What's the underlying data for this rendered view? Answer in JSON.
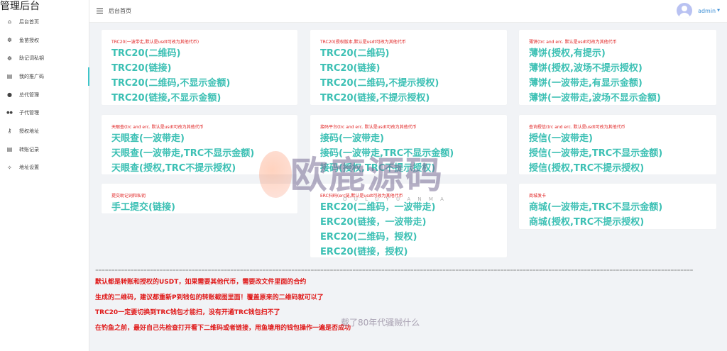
{
  "app": {
    "title": "管理后台"
  },
  "header": {
    "breadcrumb": "后台首页",
    "user": "admin",
    "caret": "▼"
  },
  "sidebar": {
    "items": [
      {
        "label": "后台首页",
        "icon": "home-icon",
        "glyph": "⌂"
      },
      {
        "label": "鱼苗授权",
        "icon": "fish-icon",
        "glyph": "☸"
      },
      {
        "label": "助记词私钥",
        "icon": "fish-icon",
        "glyph": "☸"
      },
      {
        "label": "我的推广码",
        "icon": "document-icon",
        "glyph": "▤"
      },
      {
        "label": "总代管理",
        "icon": "user-icon",
        "glyph": "●"
      },
      {
        "label": "子代管理",
        "icon": "users-icon",
        "glyph": "●●"
      },
      {
        "label": "授权地址",
        "icon": "key-icon",
        "glyph": "⚷"
      },
      {
        "label": "转账记录",
        "icon": "list-icon",
        "glyph": "▤"
      },
      {
        "label": "地址设置",
        "icon": "settings-icon",
        "glyph": "✧"
      }
    ]
  },
  "cards": [
    {
      "title": "TRC20(一波带走,默认是usdt可改为其他代币)",
      "links": [
        "TRC20(二维码)",
        "TRC20(链接)",
        "TRC20(二维码,不显示金额)",
        "TRC20(链接,不显示金额)"
      ]
    },
    {
      "title": "TRC20(授权版本,默认是usdt可改为其他代币",
      "links": [
        "TRC20(二维码)",
        "TRC20(链接)",
        "TRC20(二维码,不提示授权)",
        "TRC20(链接,不提示授权)"
      ]
    },
    {
      "title": "薄饼(trc and erc. 默认是usdt可改为其他代币",
      "links": [
        "薄饼(授权,有提示)",
        "薄饼(授权,波场不提示授权)",
        "薄饼(一波带走,有显示金额)",
        "薄饼(一波带走,波场不显示金额)"
      ]
    },
    {
      "title": "天眼查(trc and erc. 默认是usdt可改为其他代币",
      "links": [
        "天眼查(一波带走)",
        "天眼查(一波带走,TRC不显示金额)",
        "天眼查(授权,TRC不提示授权)"
      ]
    },
    {
      "title": "接码平台(trc and erc. 默认是usdt可改为其他代币",
      "links": [
        "接码(一波带走)",
        "接码(一波带走,TRC不显示金额)",
        "接码(授权,TRC不提示授权)"
      ]
    },
    {
      "title": "查询授信(trc and erc. 默认是usdt可改为其他代币",
      "links": [
        "授信(一波带走)",
        "授信(一波带走,TRC不显示金额)",
        "授信(授权,TRC不提示授权)"
      ]
    },
    {
      "title": "提交助记词和私钥",
      "links": [
        "手工提交(链接)"
      ]
    },
    {
      "title": "ERC扫码(erc链,默认是usdt可改为其他代币",
      "links": [
        "ERC20(二维码，一波带走)",
        "ERC20(链接，一波带走)",
        "ERC20(二维码，授权)",
        "ERC20(链接，授权)"
      ]
    },
    {
      "title": "商城发卡",
      "links": [
        "商城(一波带走,TRC不显示金额)",
        "商城(授权,TRC不提示授权)"
      ]
    }
  ],
  "notes": [
    "默认都是转账和授权的USDT，如果需要其他代币，需要改文件里面的合约",
    "生成的二维码，建议都重新P到钱包的转账截图里面！覆盖原来的二维码就可以了",
    "TRC20一定要切换到TRC钱包才能扫，没有开通TRC钱包扫不了",
    "在钓鱼之前，最好自己先检查打开看下二维码或者链接，用鱼塘用的钱包操作一遍是否成功"
  ],
  "divider": "==========================================================================================================================================================================================",
  "watermark": {
    "text": "欧鹿源码",
    "sub": "O U L U Y U A N M A",
    "caption": "载了80年代骚贼什么"
  }
}
